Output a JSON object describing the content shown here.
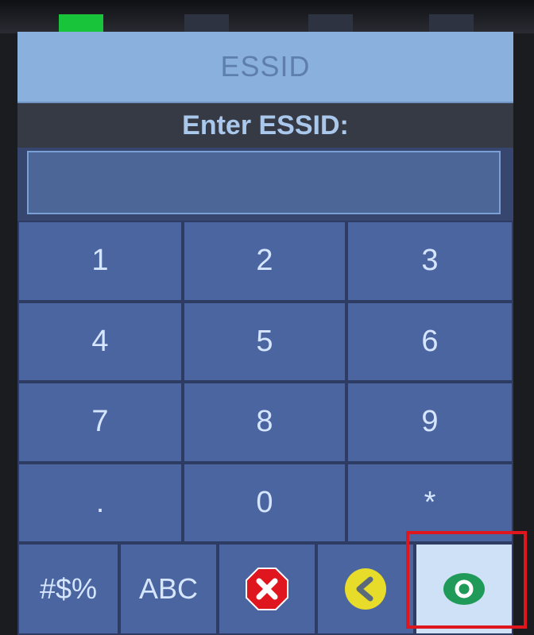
{
  "header": {
    "title": "ESSID"
  },
  "prompt": {
    "label": "Enter ESSID:"
  },
  "input": {
    "value": ""
  },
  "keypad": {
    "keys": [
      "1",
      "2",
      "3",
      "4",
      "5",
      "6",
      "7",
      "8",
      "9",
      ".",
      "0",
      "*"
    ]
  },
  "bottom_bar": {
    "symbols_label": "#$%",
    "letters_label": "ABC",
    "cancel_icon": "cancel-x-icon",
    "backspace_icon": "backspace-icon",
    "confirm_icon": "confirm-ok-icon"
  },
  "colors": {
    "title_bar": "#8ab0de",
    "key_background": "#4a65a0",
    "cancel": "#e0161e",
    "backspace": "#e8dc2a",
    "confirm": "#1f9a58",
    "highlight": "#e0161e"
  }
}
